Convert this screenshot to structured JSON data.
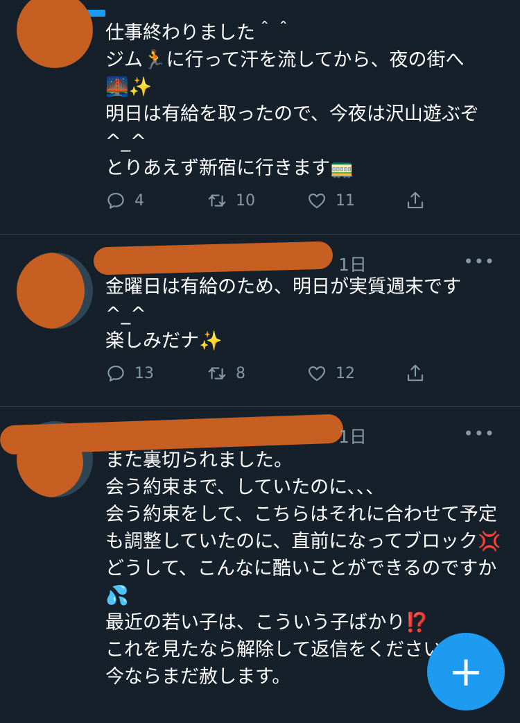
{
  "tweets": [
    {
      "date": "",
      "text": "仕事終わりました＾＾\nジム🏃に行って汗を流してから、夜の街へ\n🌉✨\n明日は有給を取ったので、今夜は沢山遊ぶぞ\n^_^\nとりあえず新宿に行きます🚃",
      "replies": "4",
      "retweets": "10",
      "likes": "11"
    },
    {
      "date": "1日",
      "more": "•••",
      "text": "金曜日は有給のため、明日が実質週末です\n^_^\n楽しみだナ✨",
      "replies": "13",
      "retweets": "8",
      "likes": "12"
    },
    {
      "date": "1日",
      "more": "•••",
      "text": "また裏切られました。\n会う約束まで、していたのに、、、\n会う約束をして、こちらはそれに合わせて予定も調整していたのに、直前になってブロック💢\nどうして、こんなに酷いことができるのですか💦\n最近の若い子は、こういう子ばかり⁉️\nこれを見たなら解除して返信をください\n今ならまだ赦します。"
    }
  ],
  "fab": {
    "label": "+"
  },
  "colors": {
    "background": "#15202b",
    "accent": "#1d9bf0",
    "muted": "#8899a6",
    "redaction": "#c75f22"
  },
  "icons": [
    "reply-icon",
    "retweet-icon",
    "like-icon",
    "share-icon",
    "compose-icon"
  ]
}
